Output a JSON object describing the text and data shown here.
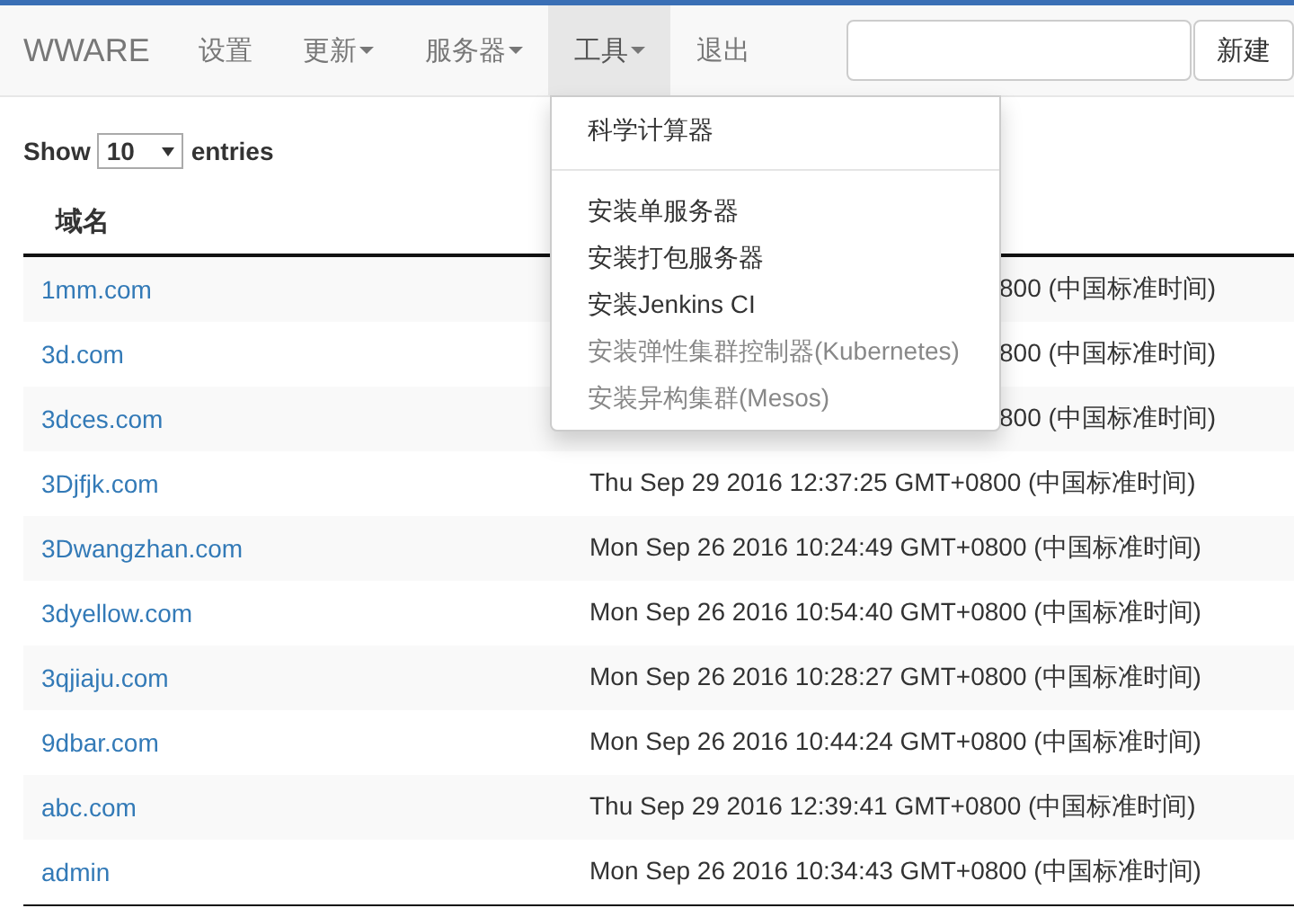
{
  "navbar": {
    "brand": "WWARE",
    "items": [
      {
        "label": "设置",
        "dropdown": false,
        "selected": false
      },
      {
        "label": "更新",
        "dropdown": true,
        "selected": false
      },
      {
        "label": "服务器",
        "dropdown": true,
        "selected": false
      },
      {
        "label": "工具",
        "dropdown": true,
        "selected": true
      },
      {
        "label": "退出",
        "dropdown": false,
        "selected": false
      }
    ],
    "button": "新建"
  },
  "menu": {
    "items": [
      {
        "label": "科学计算器",
        "disabled": false,
        "divider_after": true
      },
      {
        "label": "安装单服务器",
        "disabled": false,
        "divider_after": false
      },
      {
        "label": "安装打包服务器",
        "disabled": false,
        "divider_after": false
      },
      {
        "label": "安装Jenkins CI",
        "disabled": false,
        "divider_after": false
      },
      {
        "label": "安装弹性集群控制器(Kubernetes)",
        "disabled": true,
        "divider_after": false
      },
      {
        "label": "安装异构集群(Mesos)",
        "disabled": true,
        "divider_after": false
      }
    ]
  },
  "length": {
    "before": "Show",
    "value": "10",
    "after": "entries"
  },
  "table": {
    "columns": [
      "域名"
    ],
    "rows": [
      {
        "domain": "1mm.com",
        "time": "800 (中国标准时间)",
        "partial": true
      },
      {
        "domain": "3d.com",
        "time": "800 (中国标准时间)",
        "partial": true
      },
      {
        "domain": "3dces.com",
        "time": "800 (中国标准时间)",
        "partial": true
      },
      {
        "domain": "3Djfjk.com",
        "time": "Thu Sep 29 2016 12:37:25 GMT+0800 (中国标准时间)",
        "partial": false
      },
      {
        "domain": "3Dwangzhan.com",
        "time": "Mon Sep 26 2016 10:24:49 GMT+0800 (中国标准时间)",
        "partial": false
      },
      {
        "domain": "3dyellow.com",
        "time": "Mon Sep 26 2016 10:54:40 GMT+0800 (中国标准时间)",
        "partial": false
      },
      {
        "domain": "3qjiaju.com",
        "time": "Mon Sep 26 2016 10:28:27 GMT+0800 (中国标准时间)",
        "partial": false
      },
      {
        "domain": "9dbar.com",
        "time": "Mon Sep 26 2016 10:44:24 GMT+0800 (中国标准时间)",
        "partial": false
      },
      {
        "domain": "abc.com",
        "time": "Thu Sep 29 2016 12:39:41 GMT+0800 (中国标准时间)",
        "partial": false
      },
      {
        "domain": "admin",
        "time": "Mon Sep 26 2016 10:34:43 GMT+0800 (中国标准时间)",
        "partial": false
      }
    ]
  }
}
